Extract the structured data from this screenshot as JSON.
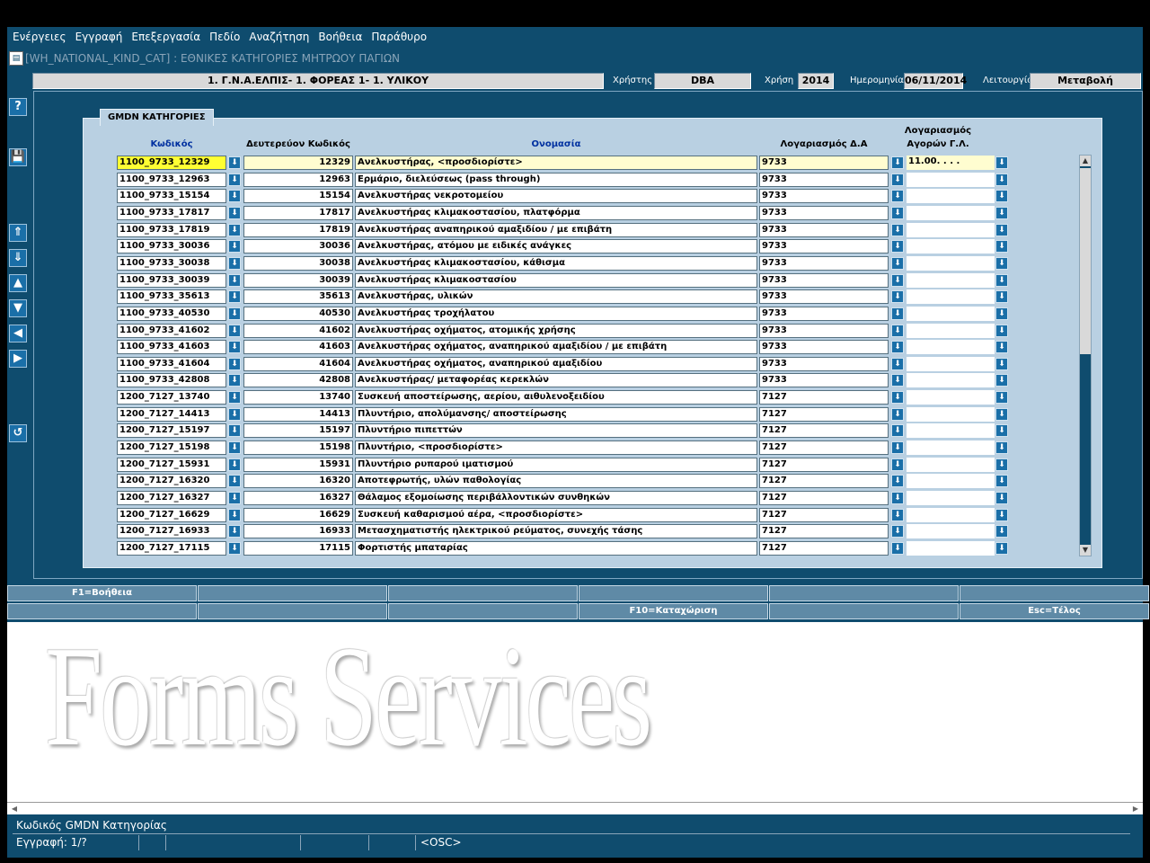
{
  "menu": [
    "Ενέργειες",
    "Εγγραφή",
    "Επεξεργασία",
    "Πεδίο",
    "Αναζήτηση",
    "Βοήθεια",
    "Παράθυρο"
  ],
  "window_title": "[WH_NATIONAL_KIND_CAT]   :  ΕΘΝΙΚΕΣ ΚΑΤΗΓΟΡΙΕΣ ΜΗΤΡΩΟΥ ΠΑΓΙΩΝ",
  "header": {
    "org": "1. Γ.Ν.Α.ΕΛΠΙΣ- 1. ΦΟΡΕΑΣ 1- 1. ΥΛΙΚΟΥ",
    "user_label": "Χρήστης",
    "user": "DBA",
    "year_label": "Χρήση",
    "year": "2014",
    "date_label": "Ημερομηνία",
    "date": "06/11/2014",
    "mode_label": "Λειτουργία",
    "mode": "Μεταβολή"
  },
  "side_buttons": [
    "?",
    "💾",
    "⇑",
    "⇓",
    "▲",
    "▼",
    "◀",
    "▶",
    "↺"
  ],
  "panel": {
    "tab": "GMDN ΚΑΤΗΓΟΡΙΕΣ",
    "headers": {
      "code": "Κωδικός",
      "secondary": "Δευτερεύον Κωδικός",
      "name": "Ονομασία",
      "account": "Λογαριασμός Δ.Α",
      "purchase_1": "Λογαριασμός",
      "purchase_2": "Αγορών Γ.Λ."
    },
    "first_purchase_value": "11.00.    .     .     ."
  },
  "rows": [
    {
      "code": "1100_9733_12329",
      "sec": "12329",
      "name": "Ανελκυστήρας, <προσδιορίστε>",
      "acc": "9733"
    },
    {
      "code": "1100_9733_12963",
      "sec": "12963",
      "name": "Ερμάριο, διελεύσεως (pass through)",
      "acc": "9733"
    },
    {
      "code": "1100_9733_15154",
      "sec": "15154",
      "name": "Ανελκυστήρας νεκροτομείου",
      "acc": "9733"
    },
    {
      "code": "1100_9733_17817",
      "sec": "17817",
      "name": "Ανελκυστήρας κλιμακοστασίου, πλατφόρμα",
      "acc": "9733"
    },
    {
      "code": "1100_9733_17819",
      "sec": "17819",
      "name": "Ανελκυστήρας αναπηρικού αμαξιδίου / με επιβάτη",
      "acc": "9733"
    },
    {
      "code": "1100_9733_30036",
      "sec": "30036",
      "name": "Ανελκυστήρας, ατόμου με ειδικές ανάγκες",
      "acc": "9733"
    },
    {
      "code": "1100_9733_30038",
      "sec": "30038",
      "name": "Ανελκυστήρας κλιμακοστασίου, κάθισμα",
      "acc": "9733"
    },
    {
      "code": "1100_9733_30039",
      "sec": "30039",
      "name": "Ανελκυστήρας κλιμακοστασίου",
      "acc": "9733"
    },
    {
      "code": "1100_9733_35613",
      "sec": "35613",
      "name": "Ανελκυστήρας, υλικών",
      "acc": "9733"
    },
    {
      "code": "1100_9733_40530",
      "sec": "40530",
      "name": "Ανελκυστήρας τροχήλατου",
      "acc": "9733"
    },
    {
      "code": "1100_9733_41602",
      "sec": "41602",
      "name": "Ανελκυστήρας οχήματος, ατομικής χρήσης",
      "acc": "9733"
    },
    {
      "code": "1100_9733_41603",
      "sec": "41603",
      "name": "Ανελκυστήρας οχήματος, αναπηρικού αμαξιδίου / με επιβάτη",
      "acc": "9733"
    },
    {
      "code": "1100_9733_41604",
      "sec": "41604",
      "name": "Ανελκυστήρας οχήματος, αναπηρικού αμαξιδίου",
      "acc": "9733"
    },
    {
      "code": "1100_9733_42808",
      "sec": "42808",
      "name": "Ανελκυστήρας/ μεταφορέας κερεκλών",
      "acc": "9733"
    },
    {
      "code": "1200_7127_13740",
      "sec": "13740",
      "name": "Συσκευή αποστείρωσης, αερίου, αιθυλενοξειδίου",
      "acc": "7127"
    },
    {
      "code": "1200_7127_14413",
      "sec": "14413",
      "name": "Πλυντήριο, απολύμανσης/ αποστείρωσης",
      "acc": "7127"
    },
    {
      "code": "1200_7127_15197",
      "sec": "15197",
      "name": "Πλυντήριο πιπεττών",
      "acc": "7127"
    },
    {
      "code": "1200_7127_15198",
      "sec": "15198",
      "name": "Πλυντήριο, <προσδιορίστε>",
      "acc": "7127"
    },
    {
      "code": "1200_7127_15931",
      "sec": "15931",
      "name": "Πλυντήριο ρυπαρού ιματισμού",
      "acc": "7127"
    },
    {
      "code": "1200_7127_16320",
      "sec": "16320",
      "name": "Αποτεφρωτής, υλών παθολογίας",
      "acc": "7127"
    },
    {
      "code": "1200_7127_16327",
      "sec": "16327",
      "name": "Θάλαμος εξομοίωσης περιβάλλοντικών συνθηκών",
      "acc": "7127"
    },
    {
      "code": "1200_7127_16629",
      "sec": "16629",
      "name": "Συσκευή καθαρισμού αέρα, <προσδιορίστε>",
      "acc": "7127"
    },
    {
      "code": "1200_7127_16933",
      "sec": "16933",
      "name": "Μετασχηματιστής ηλεκτρικού ρεύματος, συνεχής τάσης",
      "acc": "7127"
    },
    {
      "code": "1200_7127_17115",
      "sec": "17115",
      "name": "Φορτιστής μπαταρίας",
      "acc": "7127"
    }
  ],
  "fkeys_row1": [
    "F1=Βοήθεια",
    "",
    "",
    "",
    "",
    ""
  ],
  "fkeys_row2": [
    "",
    "",
    "",
    "F10=Καταχώριση",
    "",
    "Esc=Τέλος"
  ],
  "watermark": "Forms Services",
  "status": {
    "hint": "Κωδικός GMDN Κατηγορίας",
    "record": "Εγγραφή: 1/?",
    "osc": "<OSC>"
  }
}
